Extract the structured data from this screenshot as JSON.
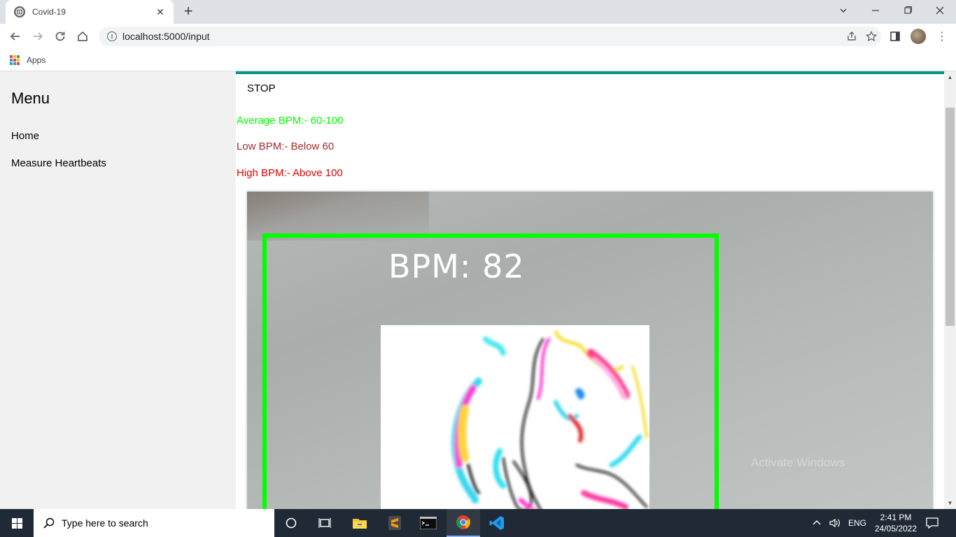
{
  "browser": {
    "tab_title": "Covid-19",
    "tab_close": "✕",
    "new_tab": "+",
    "url": "localhost:5000/input",
    "bookmarks_apps": "Apps"
  },
  "sidebar": {
    "title": "Menu",
    "items": [
      {
        "label": "Home"
      },
      {
        "label": "Measure Heartbeats"
      }
    ]
  },
  "main": {
    "stop_label": "STOP",
    "legend": {
      "average": "Average BPM:- 60-100",
      "low": "Low BPM:- Below 60",
      "high": "High BPM:- Above 100"
    },
    "video": {
      "bpm_overlay": "BPM: 82",
      "watermark": "Activate Windows"
    }
  },
  "taskbar": {
    "search_placeholder": "Type here to search",
    "language": "ENG",
    "time": "2:41 PM",
    "date": "24/05/2022"
  },
  "colors": {
    "accent": "#009688",
    "average": "#00ff00",
    "low": "#a52a2a",
    "high": "#e60000",
    "face_box": "#00ff00"
  },
  "icons": [
    "globe-icon",
    "close-icon",
    "plus-icon",
    "chevron-down-icon",
    "minimize-icon",
    "maximize-icon",
    "window-close-icon",
    "back-icon",
    "forward-icon",
    "reload-icon",
    "home-icon",
    "info-icon",
    "share-icon",
    "star-icon",
    "side-panel-icon",
    "kebab-icon",
    "apps-icon",
    "windows-start-icon",
    "search-icon",
    "cortana-icon",
    "task-view-icon",
    "file-explorer-icon",
    "sublime-icon",
    "terminal-icon",
    "chrome-icon",
    "vscode-icon",
    "chevron-up-icon",
    "volume-icon",
    "notification-icon"
  ]
}
